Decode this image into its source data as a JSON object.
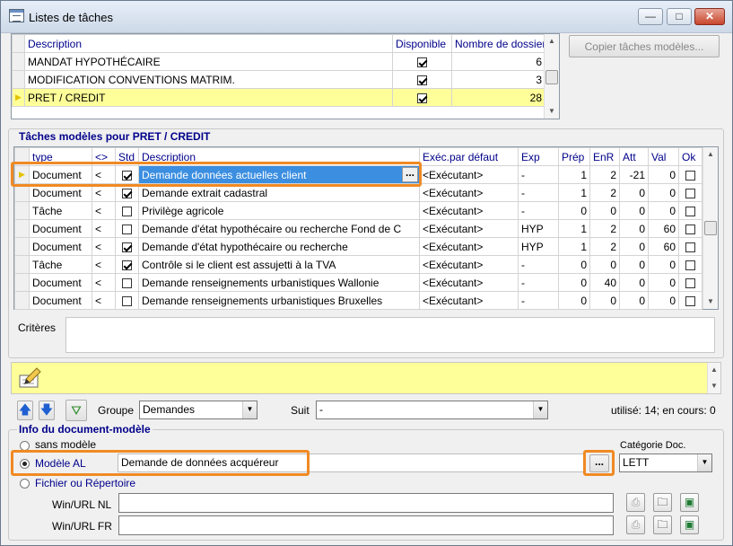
{
  "window": {
    "title": "Listes de tâches",
    "min": "—",
    "max": "□",
    "close": "✕"
  },
  "top_table": {
    "headers": [
      "Description",
      "Disponible",
      "Nombre de dossiers"
    ],
    "rows": [
      {
        "description": "MANDAT HYPOTHÉCAIRE",
        "disponible": true,
        "count": "6"
      },
      {
        "description": "MODIFICATION CONVENTIONS MATRIM.",
        "disponible": true,
        "count": "3"
      },
      {
        "description": "PRET / CREDIT",
        "disponible": true,
        "count": "28",
        "selected": true
      }
    ]
  },
  "copy_button": "Copier tâches modèles...",
  "tasks": {
    "title": "Tâches modèles pour PRET / CREDIT",
    "headers": [
      "type",
      "<>",
      "Std",
      "Description",
      "Exéc.par défaut",
      "Exp",
      "Prép",
      "EnR",
      "Att",
      "Val",
      "Ok"
    ],
    "rows": [
      {
        "type": "Document",
        "cmp": "<",
        "std": true,
        "desc": "Demande données actuelles client",
        "exec": "<Exécutant>",
        "exp": "-",
        "prep": "1",
        "enr": "2",
        "att": "-21",
        "val": "0",
        "ok": false,
        "selected": true
      },
      {
        "type": "Document",
        "cmp": "<",
        "std": true,
        "desc": "Demande extrait cadastral",
        "exec": "<Exécutant>",
        "exp": "-",
        "prep": "1",
        "enr": "2",
        "att": "0",
        "val": "0",
        "ok": false
      },
      {
        "type": "Tâche",
        "cmp": "<",
        "std": false,
        "desc": "Privilège agricole",
        "exec": "<Exécutant>",
        "exp": "-",
        "prep": "0",
        "enr": "0",
        "att": "0",
        "val": "0",
        "ok": false
      },
      {
        "type": "Document",
        "cmp": "<",
        "std": false,
        "desc": "Demande d'état hypothécaire ou recherche Fond de C",
        "exec": "<Exécutant>",
        "exp": "HYP",
        "prep": "1",
        "enr": "2",
        "att": "0",
        "val": "60",
        "ok": false
      },
      {
        "type": "Document",
        "cmp": "<",
        "std": true,
        "desc": "Demande d'état hypothécaire ou recherche",
        "exec": "<Exécutant>",
        "exp": "HYP",
        "prep": "1",
        "enr": "2",
        "att": "0",
        "val": "60",
        "ok": false
      },
      {
        "type": "Tâche",
        "cmp": "<",
        "std": true,
        "desc": "Contrôle si le client est assujetti à la TVA",
        "exec": "<Exécutant>",
        "exp": "-",
        "prep": "0",
        "enr": "0",
        "att": "0",
        "val": "0",
        "ok": false
      },
      {
        "type": "Document",
        "cmp": "<",
        "std": false,
        "desc": "Demande renseignements urbanistiques Wallonie",
        "exec": "<Exécutant>",
        "exp": "-",
        "prep": "0",
        "enr": "40",
        "att": "0",
        "val": "0",
        "ok": false
      },
      {
        "type": "Document",
        "cmp": "<",
        "std": false,
        "desc": "Demande renseignements urbanistiques Bruxelles",
        "exec": "<Exécutant>",
        "exp": "-",
        "prep": "0",
        "enr": "0",
        "att": "0",
        "val": "0",
        "ok": false
      }
    ],
    "ellipsis": "..."
  },
  "criteria": {
    "label": "Critères",
    "value": ""
  },
  "toolbar": {
    "groupe_label": "Groupe",
    "groupe_value": "Demandes",
    "suit_label": "Suit",
    "suit_value": "-",
    "status": "utilisé: 14; en cours: 0"
  },
  "doc_model": {
    "title": "Info du document-modèle",
    "sans_modele": "sans modèle",
    "modele_al": "Modèle AL",
    "modele_value": "Demande de données acquéreur",
    "fichier": "Fichier ou Répertoire",
    "categorie_label": "Catégorie Doc.",
    "categorie_value": "LETT",
    "win_nl_label": "Win/URL NL",
    "win_nl_value": "",
    "win_fr_label": "Win/URL FR",
    "win_fr_value": "",
    "ellipsis": "..."
  },
  "colors": {
    "selection": "#ffff99",
    "highlight": "#f08a24",
    "header_text": "#00008b"
  }
}
